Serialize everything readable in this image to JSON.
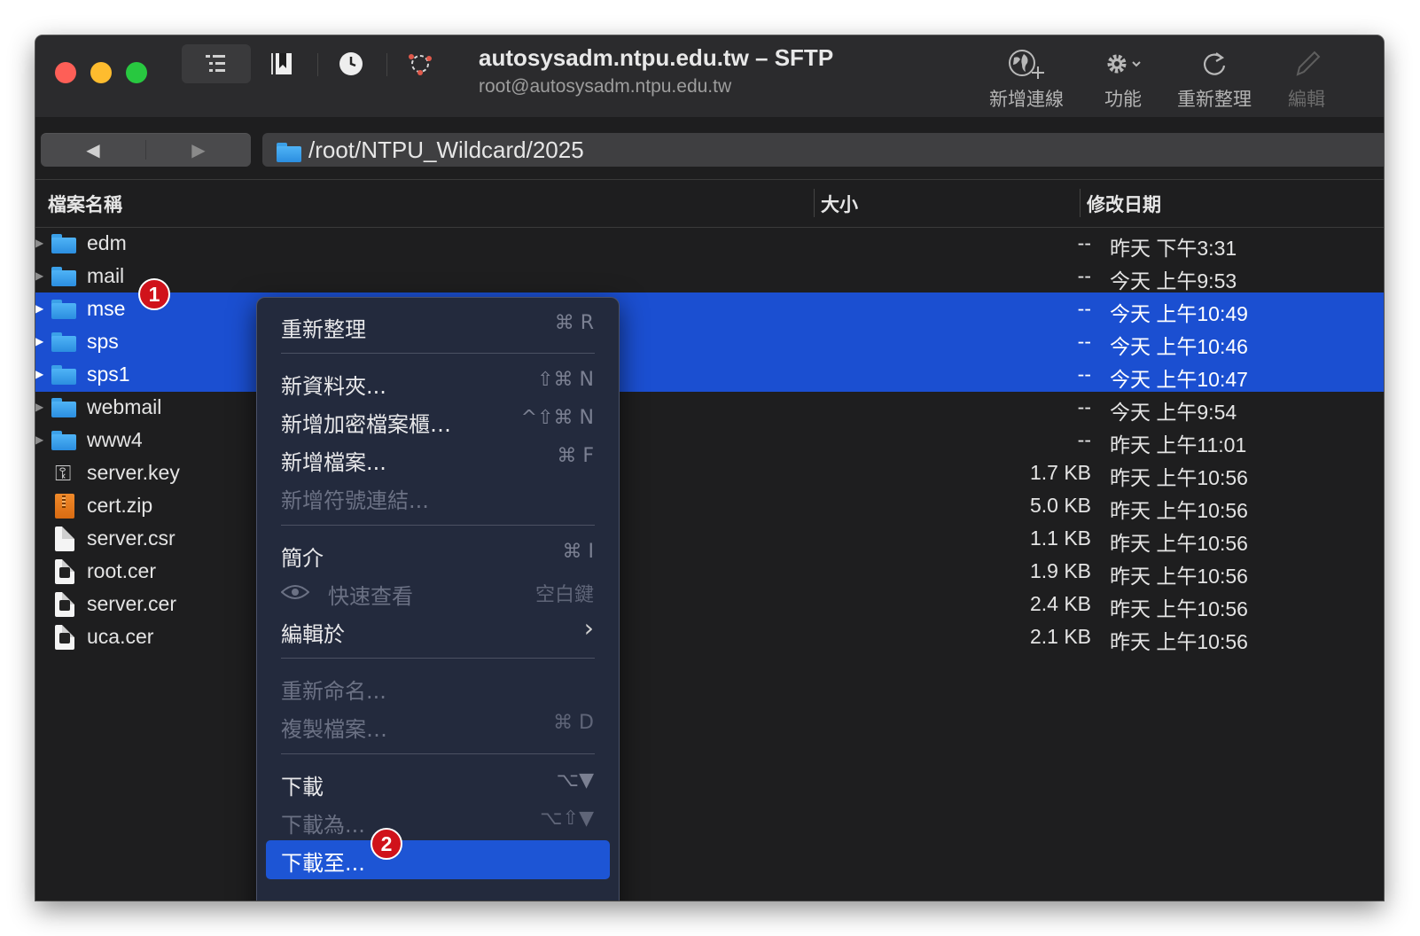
{
  "window": {
    "title": "autosysadm.ntpu.edu.tw – SFTP",
    "subtitle": "root@autosysadm.ntpu.edu.tw"
  },
  "toolbar": {
    "new_connection": "新增連線",
    "actions": "功能",
    "refresh": "重新整理",
    "edit": "編輯"
  },
  "path": {
    "value": "/root/NTPU_Wildcard/2025"
  },
  "columns": {
    "name": "檔案名稱",
    "size": "大小",
    "modified": "修改日期"
  },
  "files": [
    {
      "name": "edm",
      "size": "--",
      "modified": "昨天 下午3:31",
      "type": "folder",
      "selected": false
    },
    {
      "name": "mail",
      "size": "--",
      "modified": "今天 上午9:53",
      "type": "folder",
      "selected": false
    },
    {
      "name": "mse",
      "size": "--",
      "modified": "今天 上午10:49",
      "type": "folder",
      "selected": true
    },
    {
      "name": "sps",
      "size": "--",
      "modified": "今天 上午10:46",
      "type": "folder",
      "selected": true
    },
    {
      "name": "sps1",
      "size": "--",
      "modified": "今天 上午10:47",
      "type": "folder",
      "selected": true
    },
    {
      "name": "webmail",
      "size": "--",
      "modified": "今天 上午9:54",
      "type": "folder",
      "selected": false
    },
    {
      "name": "www4",
      "size": "--",
      "modified": "昨天 上午11:01",
      "type": "folder",
      "selected": false
    },
    {
      "name": "server.key",
      "size": "1.7 KB",
      "modified": "昨天 上午10:56",
      "type": "key",
      "selected": false
    },
    {
      "name": "cert.zip",
      "size": "5.0 KB",
      "modified": "昨天 上午10:56",
      "type": "zip",
      "selected": false
    },
    {
      "name": "server.csr",
      "size": "1.1 KB",
      "modified": "昨天 上午10:56",
      "type": "doc",
      "selected": false
    },
    {
      "name": "root.cer",
      "size": "1.9 KB",
      "modified": "昨天 上午10:56",
      "type": "cert",
      "selected": false
    },
    {
      "name": "server.cer",
      "size": "2.4 KB",
      "modified": "昨天 上午10:56",
      "type": "cert",
      "selected": false
    },
    {
      "name": "uca.cer",
      "size": "2.1 KB",
      "modified": "昨天 上午10:56",
      "type": "cert",
      "selected": false
    }
  ],
  "context_menu": {
    "refresh": {
      "label": "重新整理",
      "shortcut": "⌘ R"
    },
    "new_folder": {
      "label": "新資料夾...",
      "shortcut": "⇧⌘ N"
    },
    "new_vault": {
      "label": "新增加密檔案櫃…",
      "shortcut": "^⇧⌘ N"
    },
    "new_file": {
      "label": "新增檔案...",
      "shortcut": "⌘ F"
    },
    "new_symlink": {
      "label": "新增符號連結..."
    },
    "info": {
      "label": "簡介",
      "shortcut": "⌘ I"
    },
    "quick_look": {
      "label": "快速查看",
      "shortcut": "空白鍵"
    },
    "edit_with": {
      "label": "編輯於",
      "shortcut": "›"
    },
    "rename": {
      "label": "重新命名..."
    },
    "duplicate": {
      "label": "複製檔案…",
      "shortcut": "⌘ D"
    },
    "download": {
      "label": "下載",
      "shortcut": "⌥▼"
    },
    "download_as": {
      "label": "下載為...",
      "shortcut": "⌥⇧▼"
    },
    "download_to": {
      "label": "下載至..."
    }
  },
  "annotations": {
    "step1": "1",
    "step2": "2"
  },
  "colors": {
    "selection": "#1b4fd1",
    "menu_highlight": "#1d55d5",
    "badge": "#d0121b"
  }
}
